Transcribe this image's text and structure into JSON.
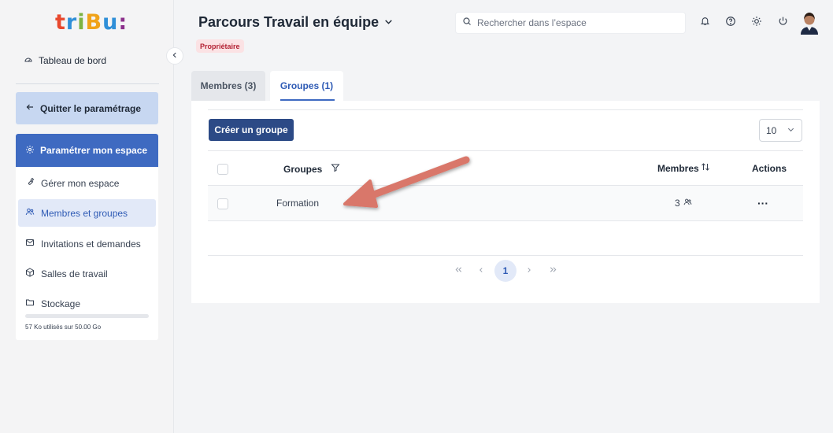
{
  "logo": {
    "letters": [
      "t",
      "r",
      "i",
      "B",
      "u",
      ":"
    ],
    "colors": [
      "#e8482d",
      "#2f8fd8",
      "#7cb342",
      "#f0a31a",
      "#2f8fd8",
      "#8b2f8b"
    ]
  },
  "sidebar": {
    "dashboard_label": "Tableau de bord",
    "quit_label": "Quitter le paramétrage",
    "settings_label": "Paramétrer mon espace",
    "items": [
      {
        "label": "Gérer mon espace",
        "icon": "wrench-icon"
      },
      {
        "label": "Membres et groupes",
        "icon": "users-icon"
      },
      {
        "label": "Invitations et demandes",
        "icon": "envelope-icon"
      },
      {
        "label": "Salles de travail",
        "icon": "cube-icon"
      },
      {
        "label": "Stockage",
        "icon": "folder-icon"
      }
    ],
    "active_item": "Membres et groupes",
    "storage_text": "57 Ko utilisés sur 50.00 Go",
    "storage_fraction": 0.0
  },
  "header": {
    "title": "Parcours Travail en équipe",
    "role_badge": "Propriétaire",
    "search_placeholder": "Rechercher dans l’espace"
  },
  "tabs": [
    {
      "label": "Membres (3)",
      "active": false
    },
    {
      "label": "Groupes (1)",
      "active": true
    }
  ],
  "toolbar": {
    "create_label": "Créer un groupe",
    "per_page": "10"
  },
  "table": {
    "headers": {
      "groups": "Groupes",
      "members": "Membres",
      "actions": "Actions"
    },
    "rows": [
      {
        "name": "Formation",
        "members": "3",
        "actions": "···"
      }
    ]
  },
  "pagination": {
    "current_page": "1"
  },
  "colors": {
    "primary": "#3e6ac1",
    "dark_button": "#2c4a86",
    "annotation_arrow": "#d9776a",
    "badge_bg": "#fbe2e4",
    "badge_text": "#b42335"
  }
}
